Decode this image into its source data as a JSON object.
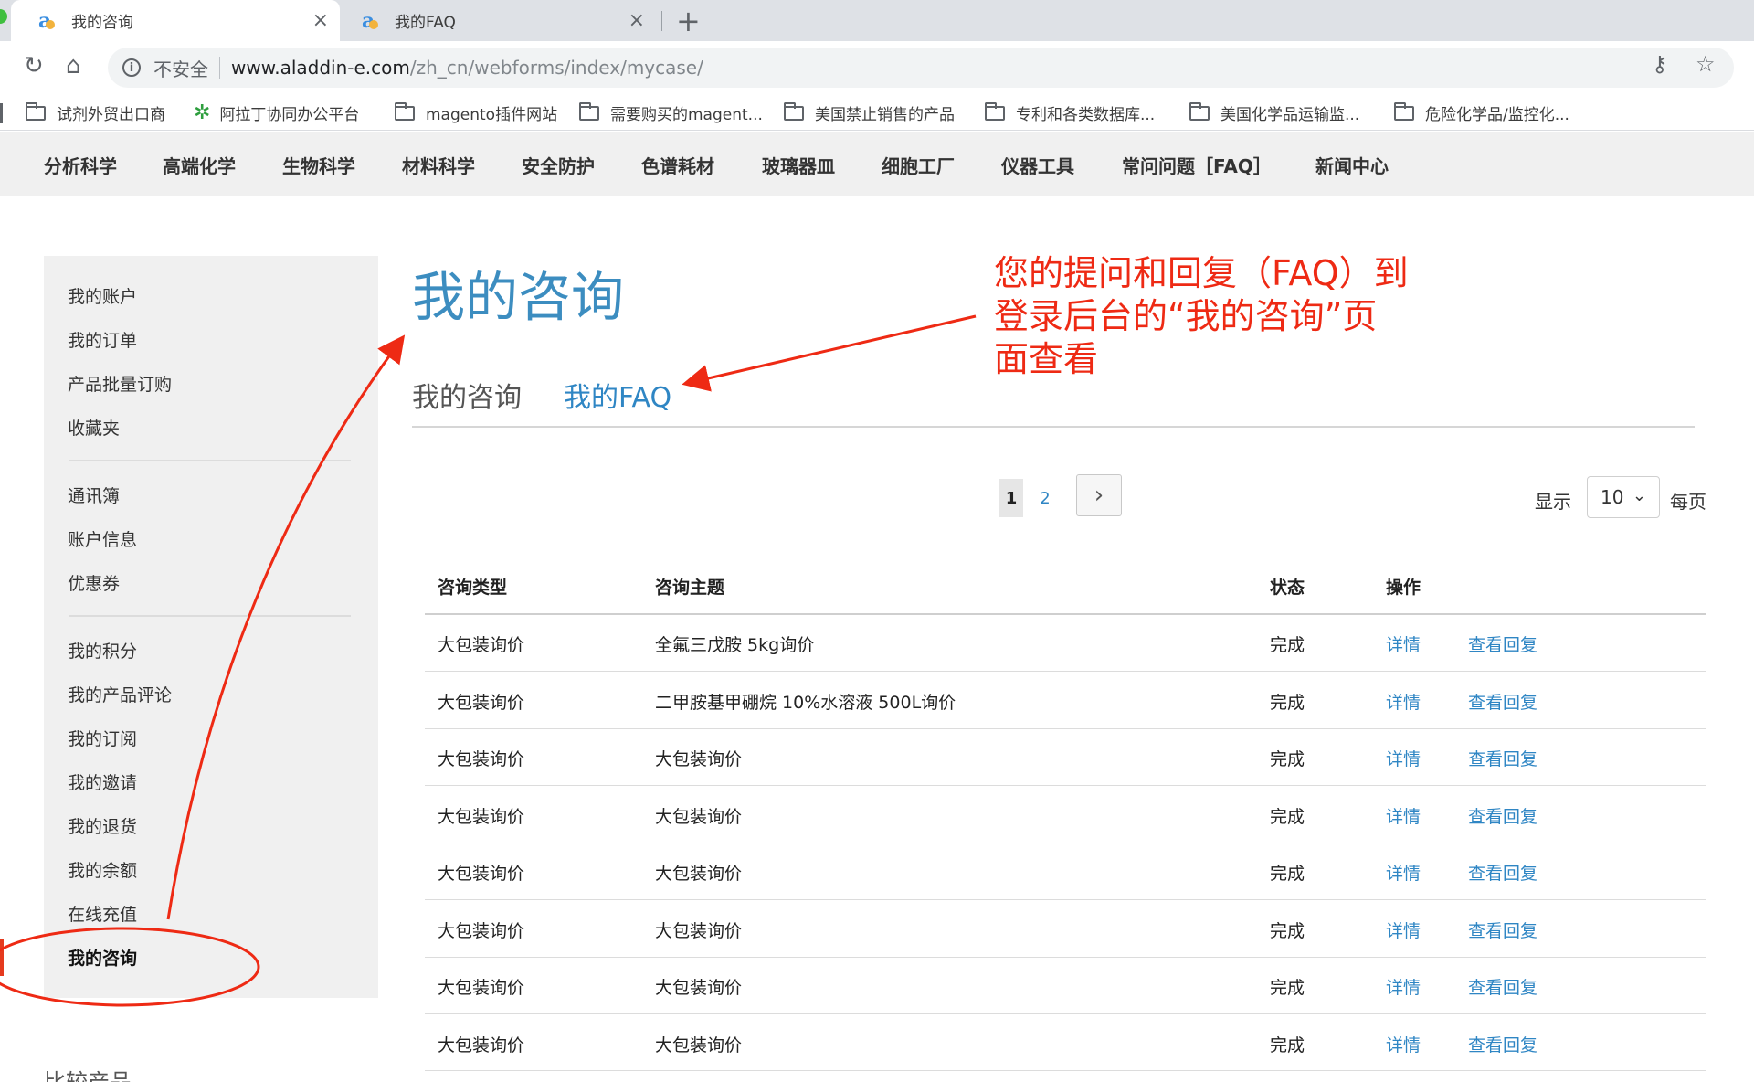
{
  "browser": {
    "tabs": [
      {
        "title": "我的咨询",
        "close": "×"
      },
      {
        "title": "我的FAQ",
        "close": "×"
      }
    ],
    "new_tab": "+",
    "security_label": "不安全",
    "url_host": "www.aladdin-e.com",
    "url_path": "/zh_cn/webforms/index/mycase/",
    "bookmarks": [
      "试剂外贸出口商",
      "阿拉丁协同办公平台",
      "magento插件网站",
      "需要购买的magent...",
      "美国禁止销售的产品",
      "专利和各类数据库...",
      "美国化学品运输监...",
      "危险化学品/监控化..."
    ]
  },
  "site_nav": [
    "分析科学",
    "高端化学",
    "生物科学",
    "材料科学",
    "安全防护",
    "色谱耗材",
    "玻璃器皿",
    "细胞工厂",
    "仪器工具",
    "常问问题［FAQ］",
    "新闻中心"
  ],
  "sidebar": {
    "groups": [
      [
        "我的账户",
        "我的订单",
        "产品批量订购",
        "收藏夹"
      ],
      [
        "通讯簿",
        "账户信息",
        "优惠券"
      ],
      [
        "我的积分",
        "我的产品评论",
        "我的订阅",
        "我的邀请",
        "我的退货",
        "我的余额",
        "在线充值",
        "我的咨询"
      ]
    ],
    "active_item": "我的咨询",
    "compare_label": "比较产品"
  },
  "main": {
    "title": "我的咨询",
    "tabs": [
      {
        "label": "我的咨询",
        "selected": true
      },
      {
        "label": "我的FAQ",
        "selected": false
      }
    ],
    "pager": {
      "current": "1",
      "pages": [
        "1",
        "2"
      ],
      "next_icon": "chevron-right-icon"
    },
    "per_page": {
      "prefix": "显示",
      "value": "10",
      "suffix": "每页"
    },
    "table": {
      "headers": [
        "咨询类型",
        "咨询主题",
        "状态",
        "操作"
      ],
      "rows": [
        {
          "type": "大包装询价",
          "subject": "全氟三戊胺 5kg询价",
          "status": "完成",
          "detail": "详情",
          "reply": "查看回复"
        },
        {
          "type": "大包装询价",
          "subject": "二甲胺基甲硼烷 10%水溶液 500L询价",
          "status": "完成",
          "detail": "详情",
          "reply": "查看回复"
        },
        {
          "type": "大包装询价",
          "subject": "大包装询价",
          "status": "完成",
          "detail": "详情",
          "reply": "查看回复"
        },
        {
          "type": "大包装询价",
          "subject": "大包装询价",
          "status": "完成",
          "detail": "详情",
          "reply": "查看回复"
        },
        {
          "type": "大包装询价",
          "subject": "大包装询价",
          "status": "完成",
          "detail": "详情",
          "reply": "查看回复"
        },
        {
          "type": "大包装询价",
          "subject": "大包装询价",
          "status": "完成",
          "detail": "详情",
          "reply": "查看回复"
        },
        {
          "type": "大包装询价",
          "subject": "大包装询价",
          "status": "完成",
          "detail": "详情",
          "reply": "查看回复"
        },
        {
          "type": "大包装询价",
          "subject": "大包装询价",
          "status": "完成",
          "detail": "详情",
          "reply": "查看回复"
        }
      ]
    }
  },
  "annotation": {
    "lines": [
      "您的提问和回复（FAQ）到",
      "登录后台的“我的咨询”页",
      "面查看"
    ],
    "color": "#ee2a14"
  },
  "colors": {
    "accent": "#3c8dc0",
    "link": "#2f86c4",
    "annotation": "#ee2a14"
  }
}
